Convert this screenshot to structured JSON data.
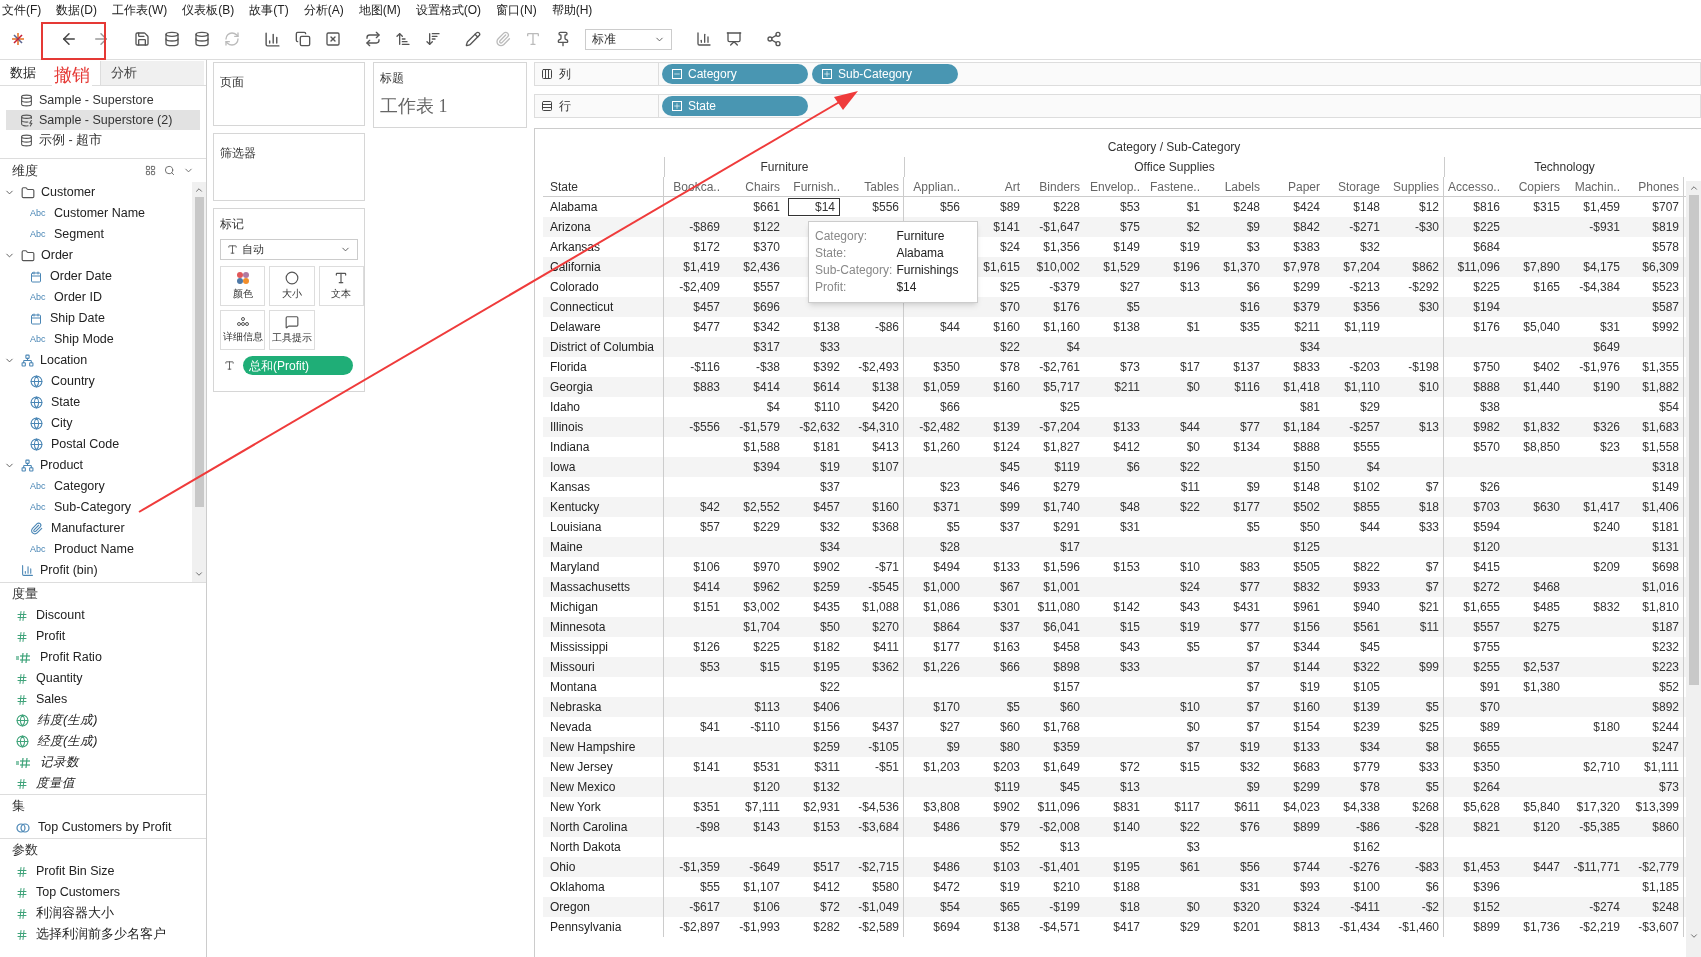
{
  "menu": [
    "文件(F)",
    "数据(D)",
    "工作表(W)",
    "仪表板(B)",
    "故事(T)",
    "分析(A)",
    "地图(M)",
    "设置格式(O)",
    "窗口(N)",
    "帮助(H)"
  ],
  "toolbar": {
    "mark_type_select": "标准"
  },
  "annotation": {
    "label": "撤销"
  },
  "left_panel": {
    "tabs": [
      {
        "label": "数据",
        "selected": true
      },
      {
        "label": "分析",
        "selected": false
      }
    ],
    "sources": [
      {
        "name": "Sample - Superstore",
        "selected": false
      },
      {
        "name": "Sample - Superstore (2)",
        "selected": true
      },
      {
        "name": "示例 - 超市",
        "selected": false
      }
    ],
    "dimensions": {
      "title": "维度",
      "items": [
        {
          "name": "Customer",
          "kind": "folder",
          "expanded": true,
          "children": [
            {
              "name": "Customer Name",
              "kind": "abc",
              "badge": "Abc"
            },
            {
              "name": "Segment",
              "kind": "abc",
              "badge": "Abc"
            }
          ]
        },
        {
          "name": "Order",
          "kind": "folder",
          "expanded": true,
          "children": [
            {
              "name": "Order Date",
              "kind": "date"
            },
            {
              "name": "Order ID",
              "kind": "abc",
              "badge": "Abc"
            },
            {
              "name": "Ship Date",
              "kind": "date"
            },
            {
              "name": "Ship Mode",
              "kind": "abc",
              "badge": "Abc"
            }
          ]
        },
        {
          "name": "Location",
          "kind": "hierarchy",
          "expanded": true,
          "children": [
            {
              "name": "Country",
              "kind": "geo"
            },
            {
              "name": "State",
              "kind": "geo"
            },
            {
              "name": "City",
              "kind": "geo"
            },
            {
              "name": "Postal Code",
              "kind": "geo"
            }
          ]
        },
        {
          "name": "Product",
          "kind": "hierarchy",
          "expanded": true,
          "children": [
            {
              "name": "Category",
              "kind": "abc",
              "badge": "Abc"
            },
            {
              "name": "Sub-Category",
              "kind": "abc",
              "badge": "Abc"
            },
            {
              "name": "Manufacturer",
              "kind": "clip"
            },
            {
              "name": "Product Name",
              "kind": "abc",
              "badge": "Abc"
            }
          ]
        },
        {
          "name": "Profit (bin)",
          "kind": "bin"
        }
      ]
    },
    "measures": {
      "title": "度量",
      "items": [
        {
          "name": "Discount",
          "kind": "measure",
          "generated": false
        },
        {
          "name": "Profit",
          "kind": "measure",
          "generated": false
        },
        {
          "name": "Profit Ratio",
          "kind": "calc",
          "generated": false
        },
        {
          "name": "Quantity",
          "kind": "measure",
          "generated": false
        },
        {
          "name": "Sales",
          "kind": "measure",
          "generated": false
        },
        {
          "name": "纬度(生成)",
          "kind": "geo",
          "generated": true
        },
        {
          "name": "经度(生成)",
          "kind": "geo",
          "generated": true
        },
        {
          "name": "记录数",
          "kind": "calc",
          "generated": true
        },
        {
          "name": "度量值",
          "kind": "measure",
          "generated": true
        }
      ]
    },
    "sets": {
      "title": "集",
      "items": [
        {
          "name": "Top Customers by Profit",
          "kind": "set"
        }
      ]
    },
    "parameters": {
      "title": "参数",
      "items": [
        {
          "name": "Profit Bin Size",
          "kind": "measure"
        },
        {
          "name": "Top Customers",
          "kind": "measure"
        },
        {
          "name": "利润容器大小",
          "kind": "measure"
        },
        {
          "name": "选择利润前多少名客户",
          "kind": "measure"
        }
      ]
    }
  },
  "cards": {
    "pages": "页面",
    "filters": "筛选器",
    "marks": {
      "title": "标记",
      "mark_type": "自动",
      "buttons": [
        {
          "label": "颜色",
          "kind": "color"
        },
        {
          "label": "大小",
          "kind": "size"
        },
        {
          "label": "文本",
          "kind": "text"
        },
        {
          "label": "详细信息",
          "kind": "detail"
        },
        {
          "label": "工具提示",
          "kind": "tooltip"
        }
      ],
      "pills": [
        {
          "label": "总和(Profit)",
          "kind": "text"
        }
      ]
    },
    "title": {
      "label": "标题",
      "text": "工作表 1"
    }
  },
  "shelves": [
    {
      "label": "列",
      "kind": "columns",
      "pills": [
        {
          "label": "Category",
          "expanded": true
        },
        {
          "label": "Sub-Category",
          "expanded": false
        }
      ]
    },
    {
      "label": "行",
      "kind": "rows",
      "pills": [
        {
          "label": "State",
          "expanded": false
        }
      ]
    }
  ],
  "table": {
    "title": "Category / Sub-Category",
    "row_header": "State",
    "groups": [
      {
        "name": "Furniture",
        "columns": [
          "Bookca..",
          "Chairs",
          "Furnish..",
          "Tables"
        ]
      },
      {
        "name": "Office Supplies",
        "columns": [
          "Applian..",
          "Art",
          "Binders",
          "Envelop..",
          "Fastene..",
          "Labels",
          "Paper",
          "Storage",
          "Supplies"
        ]
      },
      {
        "name": "Technology",
        "columns": [
          "Accesso..",
          "Copiers",
          "Machin..",
          "Phones"
        ]
      }
    ],
    "rows": [
      {
        "state": "Alabama",
        "values": [
          {
            "kind": "blank"
          },
          "$661",
          {
            "kind": "selected",
            "text": "$14"
          },
          "$556",
          "$56",
          "$89",
          "$228",
          "$53",
          "$1",
          "$248",
          "$424",
          "$148",
          "$12",
          "$816",
          "$315",
          "$1,459",
          "$707"
        ]
      },
      {
        "state": "Arizona",
        "values": [
          "-$869",
          "$122",
          {
            "kind": "blank"
          },
          {
            "kind": "blank"
          },
          {
            "kind": "blank"
          },
          "$141",
          "-$1,647",
          "$75",
          "$2",
          "$9",
          "$842",
          "-$271",
          "-$30",
          "$225",
          {
            "kind": "blank"
          },
          "-$931",
          "$819"
        ]
      },
      {
        "state": "Arkansas",
        "values": [
          "$172",
          "$370",
          {
            "kind": "blank"
          },
          {
            "kind": "blank"
          },
          {
            "kind": "blank"
          },
          "$24",
          "$1,356",
          "$149",
          "$19",
          "$3",
          "$383",
          "$32",
          {
            "kind": "blank"
          },
          "$684",
          {
            "kind": "blank"
          },
          {
            "kind": "blank"
          },
          "$578"
        ]
      },
      {
        "state": "California",
        "values": [
          "$1,419",
          "$2,436",
          {
            "kind": "blank"
          },
          {
            "kind": "blank"
          },
          {
            "kind": "blank"
          },
          "$1,615",
          "$10,002",
          "$1,529",
          "$196",
          "$1,370",
          "$7,978",
          "$7,204",
          "$862",
          "$11,096",
          "$7,890",
          "$4,175",
          "$6,309"
        ]
      },
      {
        "state": "Colorado",
        "values": [
          "-$2,409",
          "$557",
          {
            "kind": "blank"
          },
          {
            "kind": "blank"
          },
          {
            "kind": "blank"
          },
          "$25",
          "-$379",
          "$27",
          "$13",
          "$6",
          "$299",
          "-$213",
          "-$292",
          "$225",
          "$165",
          "-$4,384",
          "$523"
        ]
      },
      {
        "state": "Connecticut",
        "values": [
          "$457",
          "$696",
          {
            "kind": "blank"
          },
          {
            "kind": "blank"
          },
          {
            "kind": "blank"
          },
          "$70",
          "$176",
          "$5",
          {
            "kind": "blank"
          },
          "$16",
          "$379",
          "$356",
          "$30",
          "$194",
          {
            "kind": "blank"
          },
          {
            "kind": "blank"
          },
          "$587"
        ]
      },
      {
        "state": "Delaware",
        "values": [
          "$477",
          "$342",
          "$138",
          "-$86",
          "$44",
          "$160",
          "$1,160",
          "$138",
          "$1",
          "$35",
          "$211",
          "$1,119",
          {
            "kind": "blank"
          },
          "$176",
          "$5,040",
          "$31",
          "$992"
        ]
      },
      {
        "state": "District of Columbia",
        "values": [
          {
            "kind": "blank"
          },
          "$317",
          "$33",
          {
            "kind": "blank"
          },
          {
            "kind": "blank"
          },
          "$22",
          "$4",
          {
            "kind": "blank"
          },
          {
            "kind": "blank"
          },
          {
            "kind": "blank"
          },
          "$34",
          {
            "kind": "blank"
          },
          {
            "kind": "blank"
          },
          {
            "kind": "blank"
          },
          {
            "kind": "blank"
          },
          "$649",
          {
            "kind": "blank"
          }
        ]
      },
      {
        "state": "Florida",
        "values": [
          "-$116",
          "-$38",
          "$392",
          "-$2,493",
          "$350",
          "$78",
          "-$2,761",
          "$73",
          "$17",
          "$137",
          "$833",
          "-$203",
          "-$198",
          "$750",
          "$402",
          "-$1,976",
          "$1,355"
        ]
      },
      {
        "state": "Georgia",
        "values": [
          "$883",
          "$414",
          "$614",
          "$138",
          "$1,059",
          "$160",
          "$5,717",
          "$211",
          "$0",
          "$116",
          "$1,418",
          "$1,110",
          "$10",
          "$888",
          "$1,440",
          "$190",
          "$1,882"
        ]
      },
      {
        "state": "Idaho",
        "values": [
          {
            "kind": "blank"
          },
          "$4",
          "$110",
          "$420",
          "$66",
          {
            "kind": "blank"
          },
          "$25",
          {
            "kind": "blank"
          },
          {
            "kind": "blank"
          },
          {
            "kind": "blank"
          },
          "$81",
          "$29",
          {
            "kind": "blank"
          },
          "$38",
          {
            "kind": "blank"
          },
          {
            "kind": "blank"
          },
          "$54"
        ]
      },
      {
        "state": "Illinois",
        "values": [
          "-$556",
          "-$1,579",
          "-$2,632",
          "-$4,310",
          "-$2,482",
          "$139",
          "-$7,204",
          "$133",
          "$44",
          "$77",
          "$1,184",
          "-$257",
          "$13",
          "$982",
          "$1,832",
          "$326",
          "$1,683"
        ]
      },
      {
        "state": "Indiana",
        "values": [
          {
            "kind": "blank"
          },
          "$1,588",
          "$181",
          "$413",
          "$1,260",
          "$124",
          "$1,827",
          "$412",
          "$0",
          "$134",
          "$888",
          "$555",
          {
            "kind": "blank"
          },
          "$570",
          "$8,850",
          "$23",
          "$1,558"
        ]
      },
      {
        "state": "Iowa",
        "values": [
          {
            "kind": "blank"
          },
          "$394",
          "$19",
          "$107",
          {
            "kind": "blank"
          },
          "$45",
          "$119",
          "$6",
          "$22",
          {
            "kind": "blank"
          },
          "$150",
          "$4",
          {
            "kind": "blank"
          },
          {
            "kind": "blank"
          },
          {
            "kind": "blank"
          },
          {
            "kind": "blank"
          },
          "$318"
        ]
      },
      {
        "state": "Kansas",
        "values": [
          {
            "kind": "blank"
          },
          {
            "kind": "blank"
          },
          "$37",
          {
            "kind": "blank"
          },
          "$23",
          "$46",
          "$279",
          {
            "kind": "blank"
          },
          "$11",
          "$9",
          "$148",
          "$102",
          "$7",
          "$26",
          {
            "kind": "blank"
          },
          {
            "kind": "blank"
          },
          "$149"
        ]
      },
      {
        "state": "Kentucky",
        "values": [
          "$42",
          "$2,552",
          "$457",
          "$160",
          "$371",
          "$99",
          "$1,740",
          "$48",
          "$22",
          "$177",
          "$502",
          "$855",
          "$18",
          "$703",
          "$630",
          "$1,417",
          "$1,406"
        ]
      },
      {
        "state": "Louisiana",
        "values": [
          "$57",
          "$229",
          "$32",
          "$368",
          "$5",
          "$37",
          "$291",
          "$31",
          {
            "kind": "blank"
          },
          "$5",
          "$50",
          "$44",
          "$33",
          "$594",
          {
            "kind": "blank"
          },
          "$240",
          "$181"
        ]
      },
      {
        "state": "Maine",
        "values": [
          {
            "kind": "blank"
          },
          {
            "kind": "blank"
          },
          "$34",
          {
            "kind": "blank"
          },
          "$28",
          {
            "kind": "blank"
          },
          "$17",
          {
            "kind": "blank"
          },
          {
            "kind": "blank"
          },
          {
            "kind": "blank"
          },
          "$125",
          {
            "kind": "blank"
          },
          {
            "kind": "blank"
          },
          "$120",
          {
            "kind": "blank"
          },
          {
            "kind": "blank"
          },
          "$131"
        ]
      },
      {
        "state": "Maryland",
        "values": [
          "$106",
          "$970",
          "$902",
          "-$71",
          "$494",
          "$133",
          "$1,596",
          "$153",
          "$10",
          "$83",
          "$505",
          "$822",
          "$7",
          "$415",
          {
            "kind": "blank"
          },
          "$209",
          "$698"
        ]
      },
      {
        "state": "Massachusetts",
        "values": [
          "$414",
          "$962",
          "$259",
          "-$545",
          "$1,000",
          "$67",
          "$1,001",
          {
            "kind": "blank"
          },
          "$24",
          "$77",
          "$832",
          "$933",
          "$7",
          "$272",
          "$468",
          {
            "kind": "blank"
          },
          "$1,016"
        ]
      },
      {
        "state": "Michigan",
        "values": [
          "$151",
          "$3,002",
          "$435",
          "$1,088",
          "$1,086",
          "$301",
          "$11,080",
          "$142",
          "$43",
          "$431",
          "$961",
          "$940",
          "$21",
          "$1,655",
          "$485",
          "$832",
          "$1,810"
        ]
      },
      {
        "state": "Minnesota",
        "values": [
          {
            "kind": "blank"
          },
          "$1,704",
          "$50",
          "$270",
          "$864",
          "$37",
          "$6,041",
          "$15",
          "$19",
          "$77",
          "$156",
          "$561",
          "$11",
          "$557",
          "$275",
          {
            "kind": "blank"
          },
          "$187"
        ]
      },
      {
        "state": "Mississippi",
        "values": [
          "$126",
          "$225",
          "$182",
          "$411",
          "$177",
          "$163",
          "$458",
          "$43",
          "$5",
          "$7",
          "$344",
          "$45",
          {
            "kind": "blank"
          },
          "$755",
          {
            "kind": "blank"
          },
          {
            "kind": "blank"
          },
          "$232"
        ]
      },
      {
        "state": "Missouri",
        "values": [
          "$53",
          "$15",
          "$195",
          "$362",
          "$1,226",
          "$66",
          "$898",
          "$33",
          {
            "kind": "blank"
          },
          "$7",
          "$144",
          "$322",
          "$99",
          "$255",
          "$2,537",
          {
            "kind": "blank"
          },
          "$223"
        ]
      },
      {
        "state": "Montana",
        "values": [
          {
            "kind": "blank"
          },
          {
            "kind": "blank"
          },
          "$22",
          {
            "kind": "blank"
          },
          {
            "kind": "blank"
          },
          {
            "kind": "blank"
          },
          "$157",
          {
            "kind": "blank"
          },
          {
            "kind": "blank"
          },
          "$7",
          "$19",
          "$105",
          {
            "kind": "blank"
          },
          "$91",
          "$1,380",
          {
            "kind": "blank"
          },
          "$52"
        ]
      },
      {
        "state": "Nebraska",
        "values": [
          {
            "kind": "blank"
          },
          "$113",
          "$406",
          {
            "kind": "blank"
          },
          "$170",
          "$5",
          "$60",
          {
            "kind": "blank"
          },
          "$10",
          "$7",
          "$160",
          "$139",
          "$5",
          "$70",
          {
            "kind": "blank"
          },
          {
            "kind": "blank"
          },
          "$892"
        ]
      },
      {
        "state": "Nevada",
        "values": [
          "$41",
          "-$110",
          "$156",
          "$437",
          "$27",
          "$60",
          "$1,768",
          {
            "kind": "blank"
          },
          "$0",
          "$7",
          "$154",
          "$239",
          "$25",
          "$89",
          {
            "kind": "blank"
          },
          "$180",
          "$244"
        ]
      },
      {
        "state": "New Hampshire",
        "values": [
          {
            "kind": "blank"
          },
          {
            "kind": "blank"
          },
          "$259",
          "-$105",
          "$9",
          "$80",
          "$359",
          {
            "kind": "blank"
          },
          "$7",
          "$19",
          "$133",
          "$34",
          "$8",
          "$655",
          {
            "kind": "blank"
          },
          {
            "kind": "blank"
          },
          "$247"
        ]
      },
      {
        "state": "New Jersey",
        "values": [
          "$141",
          "$531",
          "$311",
          "-$51",
          "$1,203",
          "$203",
          "$1,649",
          "$72",
          "$15",
          "$32",
          "$683",
          "$779",
          "$33",
          "$350",
          {
            "kind": "blank"
          },
          "$2,710",
          "$1,111"
        ]
      },
      {
        "state": "New Mexico",
        "values": [
          {
            "kind": "blank"
          },
          "$120",
          "$132",
          {
            "kind": "blank"
          },
          {
            "kind": "blank"
          },
          "$119",
          "$45",
          "$13",
          {
            "kind": "blank"
          },
          "$9",
          "$299",
          "$78",
          "$5",
          "$264",
          {
            "kind": "blank"
          },
          {
            "kind": "blank"
          },
          "$73"
        ]
      },
      {
        "state": "New York",
        "values": [
          "$351",
          "$7,111",
          "$2,931",
          "-$4,536",
          "$3,808",
          "$902",
          "$11,096",
          "$831",
          "$117",
          "$611",
          "$4,023",
          "$4,338",
          "$268",
          "$5,628",
          "$5,840",
          "$17,320",
          "$13,399"
        ]
      },
      {
        "state": "North Carolina",
        "values": [
          "-$98",
          "$143",
          "$153",
          "-$3,684",
          "$486",
          "$79",
          "-$2,008",
          "$140",
          "$22",
          "$76",
          "$899",
          "-$86",
          "-$28",
          "$821",
          "$120",
          "-$5,385",
          "$860"
        ]
      },
      {
        "state": "North Dakota",
        "values": [
          {
            "kind": "blank"
          },
          {
            "kind": "blank"
          },
          {
            "kind": "blank"
          },
          {
            "kind": "blank"
          },
          {
            "kind": "blank"
          },
          "$52",
          "$13",
          {
            "kind": "blank"
          },
          "$3",
          {
            "kind": "blank"
          },
          {
            "kind": "blank"
          },
          "$162",
          {
            "kind": "blank"
          },
          {
            "kind": "blank"
          },
          {
            "kind": "blank"
          },
          {
            "kind": "blank"
          },
          {
            "kind": "blank"
          }
        ]
      },
      {
        "state": "Ohio",
        "values": [
          "-$1,359",
          "-$649",
          "$517",
          "-$2,715",
          "$486",
          "$103",
          "-$1,401",
          "$195",
          "$61",
          "$56",
          "$744",
          "-$276",
          "-$83",
          "$1,453",
          "$447",
          "-$11,771",
          "-$2,779"
        ]
      },
      {
        "state": "Oklahoma",
        "values": [
          "$55",
          "$1,107",
          "$412",
          "$580",
          "$472",
          "$19",
          "$210",
          "$188",
          {
            "kind": "blank"
          },
          "$31",
          "$93",
          "$100",
          "$6",
          "$396",
          {
            "kind": "blank"
          },
          {
            "kind": "blank"
          },
          "$1,185"
        ]
      },
      {
        "state": "Oregon",
        "values": [
          "-$617",
          "$106",
          "$72",
          "-$1,049",
          "$54",
          "$65",
          "-$199",
          "$18",
          "$0",
          "$320",
          "$324",
          "-$411",
          "-$2",
          "$152",
          {
            "kind": "blank"
          },
          "-$274",
          "$248"
        ]
      },
      {
        "state": "Pennsylvania",
        "values": [
          "-$2,897",
          "-$1,993",
          "$282",
          "-$2,589",
          "$694",
          "$138",
          "-$4,571",
          "$417",
          "$29",
          "$201",
          "$813",
          "-$1,434",
          "-$1,460",
          "$899",
          "$1,736",
          "-$2,219",
          "-$3,607"
        ]
      }
    ]
  },
  "tooltip": [
    {
      "label": "Category:",
      "value": "Furniture"
    },
    {
      "label": "State:",
      "value": "Alabama"
    },
    {
      "label": "Sub-Category:",
      "value": "Furnishings"
    },
    {
      "label": "Profit:",
      "value": "$14"
    }
  ]
}
